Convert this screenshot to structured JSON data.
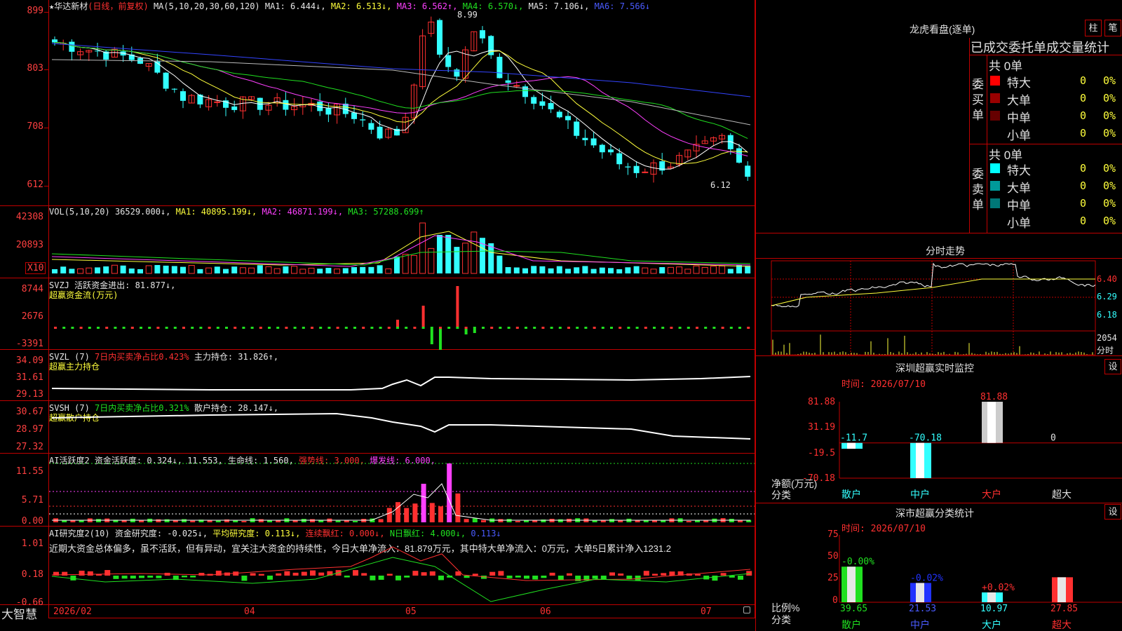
{
  "stock": {
    "name": "华达新材",
    "mode": "(日线，前复权)"
  },
  "main_header": {
    "ma_label": "MA(5,10,20,30,60,120)",
    "ma1": "MA1: 6.444↓,",
    "ma2": "MA2: 6.513↓,",
    "ma3": "MA3: 6.562↑,",
    "ma4": "MA4: 6.570↓,",
    "ma5": "MA5: 7.106↓,",
    "ma6": "MA6: 7.566↓"
  },
  "main_axis": [
    "899",
    "803",
    "708",
    "612"
  ],
  "main_annotations": {
    "high": "8.99",
    "low": "6.12"
  },
  "vol_header": {
    "label": "VOL(5,10,20)",
    "value": "36529.000↓,",
    "ma1": "MA1: 40895.199↓,",
    "ma2": "MA2: 46871.199↓,",
    "ma3": "MA3: 57288.699↑"
  },
  "vol_axis": [
    "42308",
    "20893"
  ],
  "vol_unit": "X10",
  "svzj_header": {
    "label": "SVZJ",
    "desc": "活跃资金进出: 81.877↓,",
    "sub": "超赢资金流(万元)"
  },
  "svzj_axis": [
    "8744",
    "2676",
    "-3391"
  ],
  "svzl_header": {
    "label": "SVZL (7)",
    "desc": "7日内买卖净占比0.423%",
    "hold": "主力持仓: 31.826↑,",
    "sub": "超赢主力持仓"
  },
  "svzl_axis": [
    "34.09",
    "31.61",
    "29.13"
  ],
  "svsh_header": {
    "label": "SVSH (7)",
    "desc": "7日内买卖净占比0.321%",
    "hold": "散户持仓: 28.147↓,",
    "sub": "超赢散户持仓"
  },
  "svsh_axis": [
    "30.67",
    "28.97",
    "27.32"
  ],
  "ai1_header": {
    "label": "AI活跃度2",
    "a": "资金活跃度: 0.324↓,",
    "b": "11.553,",
    "c": "生命线: 1.560,",
    "d": "强势线: 3.000,",
    "e": "爆发线: 6.000,"
  },
  "ai1_axis": [
    "11.55",
    "5.71",
    "0.00"
  ],
  "ai2_header": {
    "label": "AI研究度2(10)",
    "a": "资金研究度: -0.025↓,",
    "b": "平均研究度: 0.113↓,",
    "c": "连续飘红: 0.000↓,",
    "d": "N日飘红: 4.000↓,",
    "e": "0.113↓"
  },
  "ai2_text": "近期大资金总体偏多，虽不活跃，但有异动，宜关注大资金的持续性，今日大单净流入：81.879万元，其中特大单净流入：0万元，大单5日累计净入1231.2",
  "ai2_axis": [
    "1.01",
    "0.18",
    "-0.66"
  ],
  "bottom_bar": {
    "brand": "大智慧",
    "dates": [
      "2026/02",
      "04",
      "05",
      "06",
      "07"
    ]
  },
  "dragon": {
    "title": "龙虎看盘(逐单)",
    "btn1": "柱",
    "btn2": "笔",
    "heading": "已成交委托单成交量统计",
    "buy_label": "委买单",
    "sell_label": "委卖单",
    "buy_total": "共 0单",
    "sell_total": "共 0单",
    "buy_rows": [
      {
        "name": "特大",
        "count": "0",
        "pct": "0%",
        "color": "#ff0000"
      },
      {
        "name": "大单",
        "count": "0",
        "pct": "0%",
        "color": "#990000"
      },
      {
        "name": "中单",
        "count": "0",
        "pct": "0%",
        "color": "#660000"
      },
      {
        "name": "小单",
        "count": "0",
        "pct": "0%",
        "color": ""
      }
    ],
    "sell_rows": [
      {
        "name": "特大",
        "count": "0",
        "pct": "0%",
        "color": "#00ffff"
      },
      {
        "name": "大单",
        "count": "0",
        "pct": "0%",
        "color": "#009999"
      },
      {
        "name": "中单",
        "count": "0",
        "pct": "0%",
        "color": "#007777"
      },
      {
        "name": "小单",
        "count": "0",
        "pct": "0%",
        "color": ""
      }
    ]
  },
  "intraday": {
    "title": "分时走势",
    "axis": [
      "6.40",
      "6.29",
      "6.18"
    ],
    "vol_value": "2054",
    "vol_unit": "分时"
  },
  "sz_monitor": {
    "title": "深圳超赢实时监控",
    "settings": "设",
    "time": "时间: 2026/07/10",
    "axis": [
      "81.88",
      "31.19",
      "-19.5",
      "-70.18"
    ],
    "unit_label": "净额(万元)",
    "cat_label": "分类",
    "chart_data": {
      "type": "bar",
      "categories": [
        "散户",
        "中户",
        "大户",
        "超大"
      ],
      "values": [
        -11.7,
        -70.18,
        81.88,
        0
      ],
      "value_labels": [
        "-11.7",
        "-70.18",
        "81.88",
        "0"
      ],
      "ylim": [
        -70.18,
        81.88
      ]
    }
  },
  "sz_stats": {
    "title": "深市超赢分类统计",
    "settings": "设",
    "time": "时间: 2026/07/10",
    "axis": [
      "75",
      "50",
      "25",
      "0"
    ],
    "unit_label": "比例%",
    "cat_label": "分类",
    "chart_data": {
      "type": "bar",
      "categories": [
        "散户",
        "中户",
        "大户",
        "超大"
      ],
      "values": [
        39.65,
        21.53,
        10.97,
        27.85
      ],
      "value_labels": [
        "39.65",
        "21.53",
        "10.97",
        "27.85"
      ],
      "change_labels": [
        "-0.00%",
        "-0.02%",
        "+0.02%",
        ""
      ],
      "ylim": [
        0,
        75
      ]
    }
  }
}
